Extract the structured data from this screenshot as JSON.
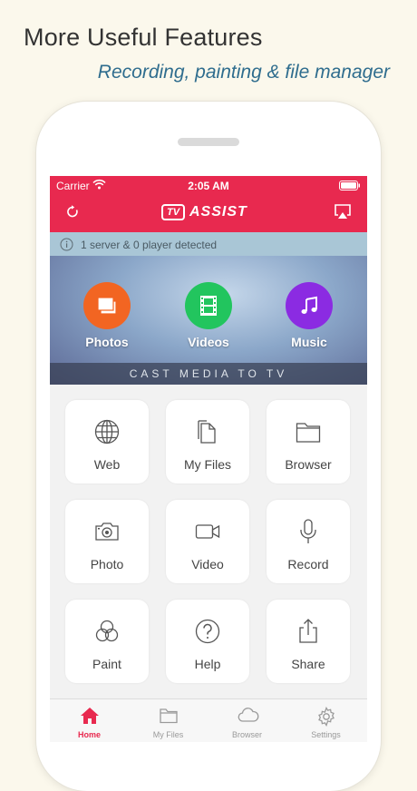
{
  "promo": {
    "title": "More Useful Features",
    "subtitle": "Recording, painting & file manager"
  },
  "status": {
    "carrier": "Carrier",
    "time": "2:05 AM"
  },
  "app": {
    "logo_badge": "TV",
    "logo_text": "ASSIST",
    "accent": "#e8294f"
  },
  "info": {
    "text": "1 server & 0 player detected"
  },
  "media": [
    {
      "label": "Photos",
      "color": "#f26522",
      "icon": "photos-icon"
    },
    {
      "label": "Videos",
      "color": "#22c55e",
      "icon": "film-icon"
    },
    {
      "label": "Music",
      "color": "#8b2be2",
      "icon": "music-note-icon"
    }
  ],
  "cast": {
    "text": "CAST MEDIA TO TV"
  },
  "tools": [
    {
      "label": "Web",
      "icon": "globe-icon"
    },
    {
      "label": "My Files",
      "icon": "files-icon"
    },
    {
      "label": "Browser",
      "icon": "folder-icon"
    },
    {
      "label": "Photo",
      "icon": "camera-icon"
    },
    {
      "label": "Video",
      "icon": "video-camera-icon"
    },
    {
      "label": "Record",
      "icon": "microphone-icon"
    },
    {
      "label": "Paint",
      "icon": "palette-icon"
    },
    {
      "label": "Help",
      "icon": "help-icon"
    },
    {
      "label": "Share",
      "icon": "share-icon"
    }
  ],
  "tabs": [
    {
      "label": "Home",
      "icon": "home-icon",
      "active": true
    },
    {
      "label": "My Files",
      "icon": "folder-icon",
      "active": false
    },
    {
      "label": "Browser",
      "icon": "cloud-icon",
      "active": false
    },
    {
      "label": "Settings",
      "icon": "gear-icon",
      "active": false
    }
  ],
  "colors": {
    "tab_active": "#e8294f",
    "tab_inactive": "#9a9a9a"
  }
}
